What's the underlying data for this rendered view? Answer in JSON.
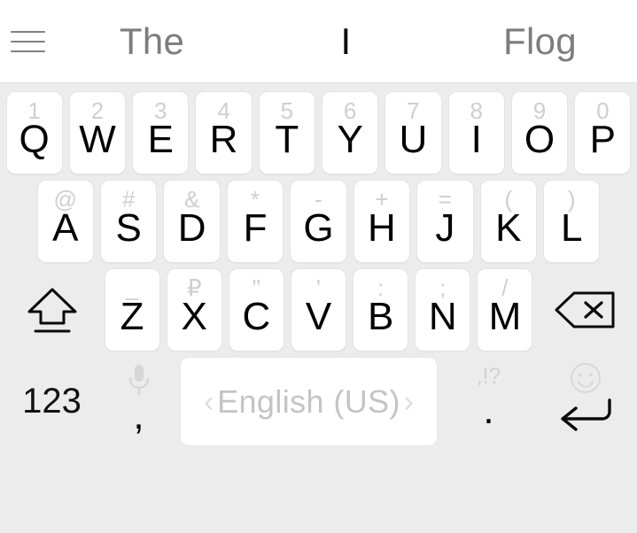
{
  "suggestion_bar": {
    "menu_icon": "hamburger-menu-icon",
    "suggestions": [
      {
        "text": "The",
        "selected": false
      },
      {
        "text": "I",
        "selected": true
      },
      {
        "text": "Flog",
        "selected": false
      }
    ]
  },
  "keyboard": {
    "row1": [
      {
        "main": "Q",
        "hint": "1"
      },
      {
        "main": "W",
        "hint": "2"
      },
      {
        "main": "E",
        "hint": "3"
      },
      {
        "main": "R",
        "hint": "4"
      },
      {
        "main": "T",
        "hint": "5"
      },
      {
        "main": "Y",
        "hint": "6"
      },
      {
        "main": "U",
        "hint": "7"
      },
      {
        "main": "I",
        "hint": "8"
      },
      {
        "main": "O",
        "hint": "9"
      },
      {
        "main": "P",
        "hint": "0"
      }
    ],
    "row2": [
      {
        "main": "A",
        "hint": "@"
      },
      {
        "main": "S",
        "hint": "#"
      },
      {
        "main": "D",
        "hint": "&"
      },
      {
        "main": "F",
        "hint": "*"
      },
      {
        "main": "G",
        "hint": "-"
      },
      {
        "main": "H",
        "hint": "+"
      },
      {
        "main": "J",
        "hint": "="
      },
      {
        "main": "K",
        "hint": "("
      },
      {
        "main": "L",
        "hint": ")"
      }
    ],
    "row3": {
      "shift_icon": "shift-caps-lock-icon",
      "keys": [
        {
          "main": "Z",
          "hint": "_"
        },
        {
          "main": "X",
          "hint": "₽"
        },
        {
          "main": "C",
          "hint": "\""
        },
        {
          "main": "V",
          "hint": "'"
        },
        {
          "main": "B",
          "hint": ":"
        },
        {
          "main": "N",
          "hint": ";"
        },
        {
          "main": "M",
          "hint": "/"
        }
      ],
      "backspace_icon": "backspace-delete-icon"
    },
    "row4": {
      "numeric_label": "123",
      "comma_label": ",",
      "mic_icon": "microphone-icon",
      "space_label": "English (US)",
      "space_prev_arrow": "‹",
      "space_next_arrow": "›",
      "period_label": ".",
      "period_hint": ",!?",
      "emoji_icon": "smiley-emoji-icon",
      "enter_icon": "enter-return-icon"
    }
  },
  "colors": {
    "keyboard_background": "#ececec",
    "key_background": "#ffffff",
    "key_border": "#e4e4e4",
    "key_text": "#000000",
    "hint_text": "#cfcfcf",
    "suggestion_text": "#7d7d7d",
    "suggestion_selected_text": "#0d0d0d",
    "space_label_text": "#c4c4c4",
    "suggestion_bar_background": "#ffffff"
  }
}
